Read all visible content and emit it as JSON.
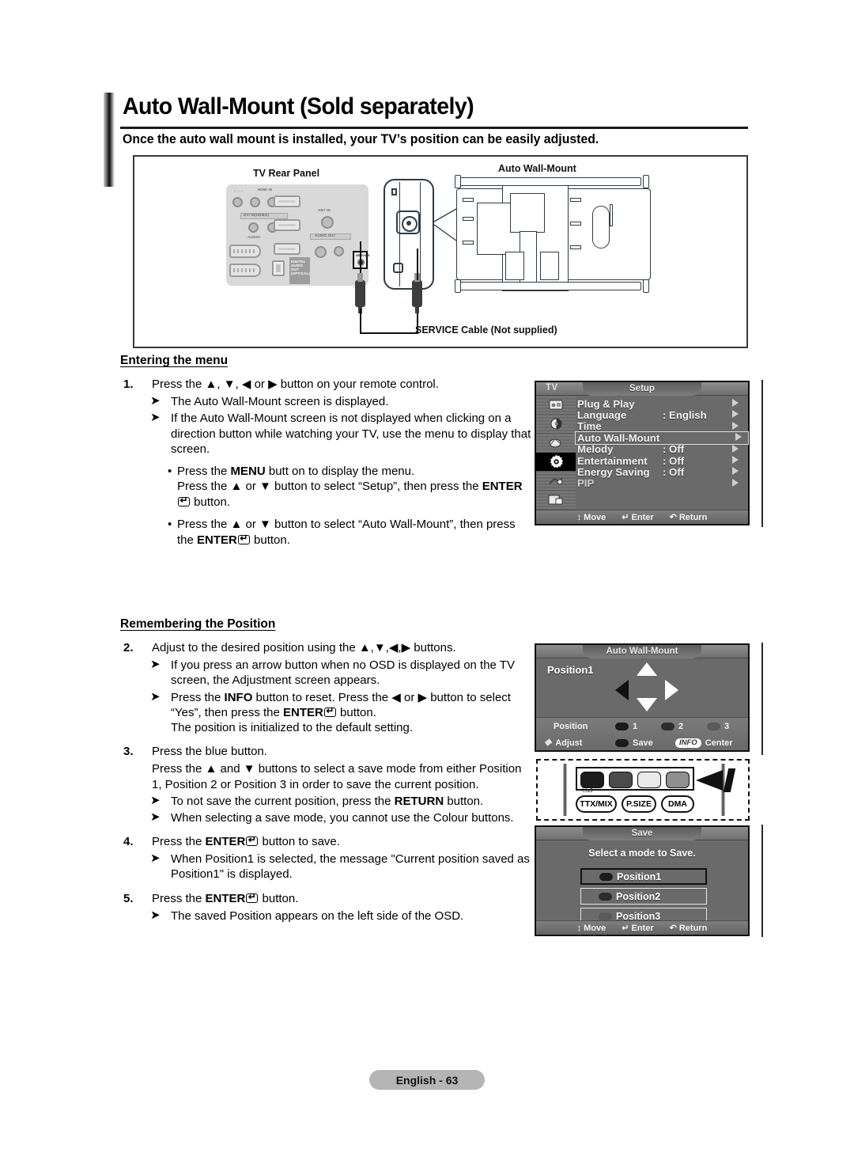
{
  "heading": {
    "title": "Auto Wall-Mount (Sold separately)",
    "subtitle": "Once the auto wall mount is installed, your TV’s position can be easily adjusted."
  },
  "diagram": {
    "tv_rear_panel_label": "TV Rear Panel",
    "auto_wall_mount_label": "Auto Wall-Mount",
    "cable_label": "SERVICE Cable (Not supplied)",
    "port_labels": {
      "hdmi_in": "HDMI IN",
      "dvi_in": "DVI IN(HDMI2)",
      "audio": "-AUDIO-",
      "ant_in": "ANT IN",
      "audio_out": "AUDIO OUT",
      "digital_audio_out": "DIGITAL AUDIO OUT (OPTICAL)",
      "service": "SERVICE"
    }
  },
  "entering_menu": {
    "title": "Entering the menu",
    "step1_num": "1.",
    "step1_text": "Press the ▲, ▼, ◀ or ▶ button on your remote control.",
    "note1": "The Auto Wall-Mount screen is displayed.",
    "note2": "If the Auto Wall-Mount screen is not displayed when clicking on a direction button while watching your TV, use the menu to display that screen.",
    "bullet1_a": "Press the ",
    "bullet1_menu": "MENU",
    "bullet1_b": " butt on to display the menu.",
    "bullet1_c": "Press the ▲ or ▼ button to select “Setup”, then press the ",
    "bullet1_enter": "ENTER",
    "bullet1_d": " button.",
    "bullet2_a": "Press the ▲ or ▼ button to select “Auto Wall-Mount”, then press the ",
    "bullet2_enter": "ENTER",
    "bullet2_b": " button."
  },
  "remembering_position": {
    "title": "Remembering the Position",
    "step2_num": "2.",
    "step2_text": "Adjust to the desired position using the ▲,▼,◀,▶ buttons.",
    "note1": "If you press an arrow button when no OSD is displayed on the TV screen, the Adjustment screen appears.",
    "note2_a": "Press the ",
    "note2_info": "INFO",
    "note2_b": " button to reset. Press the ◀ or ▶ button to select “Yes”, then press the ",
    "note2_enter": "ENTER",
    "note2_c": " button.",
    "note2_d": "The position is initialized to the default setting.",
    "step3_num": "3.",
    "step3_text": "Press the blue button.",
    "step3_text2": "Press the ▲ and ▼ buttons to select a save mode from either Position 1, Position 2 or Position 3 in order to save the current position.",
    "note3_a": "To not save the current position, press the ",
    "note3_return": "RETURN",
    "note3_b": " button.",
    "note4": "When selecting a save mode, you cannot use the Colour buttons.",
    "step4_num": "4.",
    "step4_a": "Press the ",
    "step4_enter": "ENTER",
    "step4_b": " button to save.",
    "note5": "When Position1 is selected, the message \"Current position saved as Position1\" is displayed.",
    "step5_num": "5.",
    "step5_a": "Press the ",
    "step5_enter": "ENTER",
    "step5_b": " button.",
    "note6": "The saved Position appears on the left side of the OSD."
  },
  "setup_osd": {
    "source_tag": "TV",
    "title": "Setup",
    "rows": [
      {
        "label": "Plug & Play",
        "value": ""
      },
      {
        "label": "Language",
        "value": ": English"
      },
      {
        "label": "Time",
        "value": ""
      },
      {
        "label": "Auto Wall-Mount",
        "value": ""
      },
      {
        "label": "Melody",
        "value": ": Off"
      },
      {
        "label": "Entertainment",
        "value": ": Off"
      },
      {
        "label": "Energy Saving",
        "value": ": Off"
      },
      {
        "label": "PIP",
        "value": ""
      }
    ],
    "selected_index": 3,
    "footer": {
      "move": "Move",
      "enter": "Enter",
      "return": "Return"
    },
    "icons": [
      "picture-icon",
      "sound-icon",
      "channel-icon",
      "setup-gear-icon",
      "input-icon",
      "pip-icon"
    ]
  },
  "position_osd": {
    "title": "Auto Wall-Mount",
    "position_label": "Position1",
    "footer": {
      "position_label": "Position",
      "p1": "1",
      "p2": "2",
      "p3": "3",
      "adjust": "Adjust",
      "save": "Save",
      "info": "INFO",
      "center": "Center"
    }
  },
  "remote_panel": {
    "buttons": [
      "TTX/MIX",
      "P.SIZE",
      "DMA"
    ],
    "colour_buttons": [
      "red-button",
      "green-button",
      "yellow-button",
      "blue-button"
    ]
  },
  "save_osd": {
    "title": "Save",
    "subtitle": "Select a mode to Save.",
    "items": [
      "Position1",
      "Position2",
      "Position3"
    ],
    "selected_index": 0,
    "footer": {
      "move": "Move",
      "enter": "Enter",
      "return": "Return"
    }
  },
  "footer": {
    "page": "English - 63"
  }
}
